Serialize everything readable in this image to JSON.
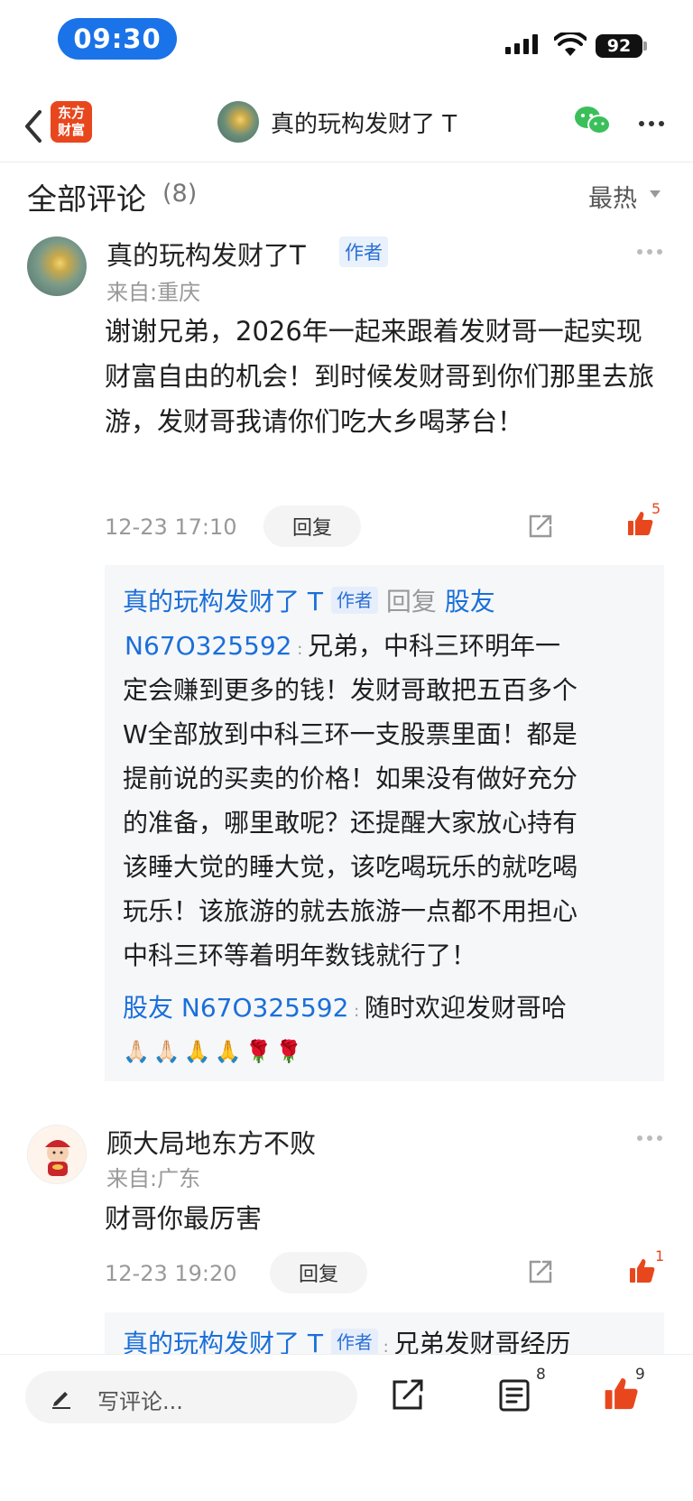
{
  "status_bar": {
    "time": "09:30",
    "battery": "92"
  },
  "nav": {
    "logo_text_1": "东方",
    "logo_text_2": "财富",
    "title": "真的玩构发财了 T"
  },
  "header": {
    "title": "全部评论",
    "count": "(8)",
    "sort": "最热"
  },
  "comment1": {
    "user": "真的玩构发财了T",
    "tag": "作者",
    "from": "来自:重庆",
    "text": "谢谢兄弟，2026年一起来跟着发财哥一起实现财富自由的机会！到时候发财哥到你们那里去旅游，发财哥我请你们吃大乡喝茅台！",
    "time": "12-23 17:10",
    "reply_label": "回复",
    "likes": "5",
    "replies": {
      "r1_user": "真的玩构发财了 T",
      "r1_tag": "作者",
      "r1_reply_word": "回复",
      "r1_target": "股友",
      "r1_target_id": "N67O325592",
      "r1_text_first": "兄弟，中科三环明年一",
      "r1_lines": [
        "定会赚到更多的钱！发财哥敢把五百多个",
        "W全部放到中科三环一支股票里面！都是",
        "提前说的买卖的价格！如果没有做好充分",
        "的准备，哪里敢呢？还提醒大家放心持有",
        "该睡大觉的睡大觉，该吃喝玩乐的就吃喝",
        "玩乐！该旅游的就去旅游一点都不用担心",
        "中科三环等着明年数钱就行了！"
      ],
      "r2_user": "股友 N67O325592",
      "r2_text": "随时欢迎发财哥哈",
      "r2_emoji": "🙏🏻🙏🏻🙏🙏🌹🌹"
    }
  },
  "comment2": {
    "user": "顾大局地东方不败",
    "from": "来自:广东",
    "text": "财哥你最厉害",
    "time": "12-23 19:20",
    "reply_label": "回复",
    "likes": "1",
    "reply_preview_user": "真的玩构发财了 T",
    "reply_preview_tag": "作者",
    "reply_preview_text": "兄弟发财哥经历"
  },
  "bottom_bar": {
    "placeholder": "写评论...",
    "comment_count": "8",
    "like_count": "9"
  },
  "colors": {
    "accent_blue": "#1a6fd9",
    "like_orange": "#e8471e",
    "time_pill": "#1a73e8"
  }
}
